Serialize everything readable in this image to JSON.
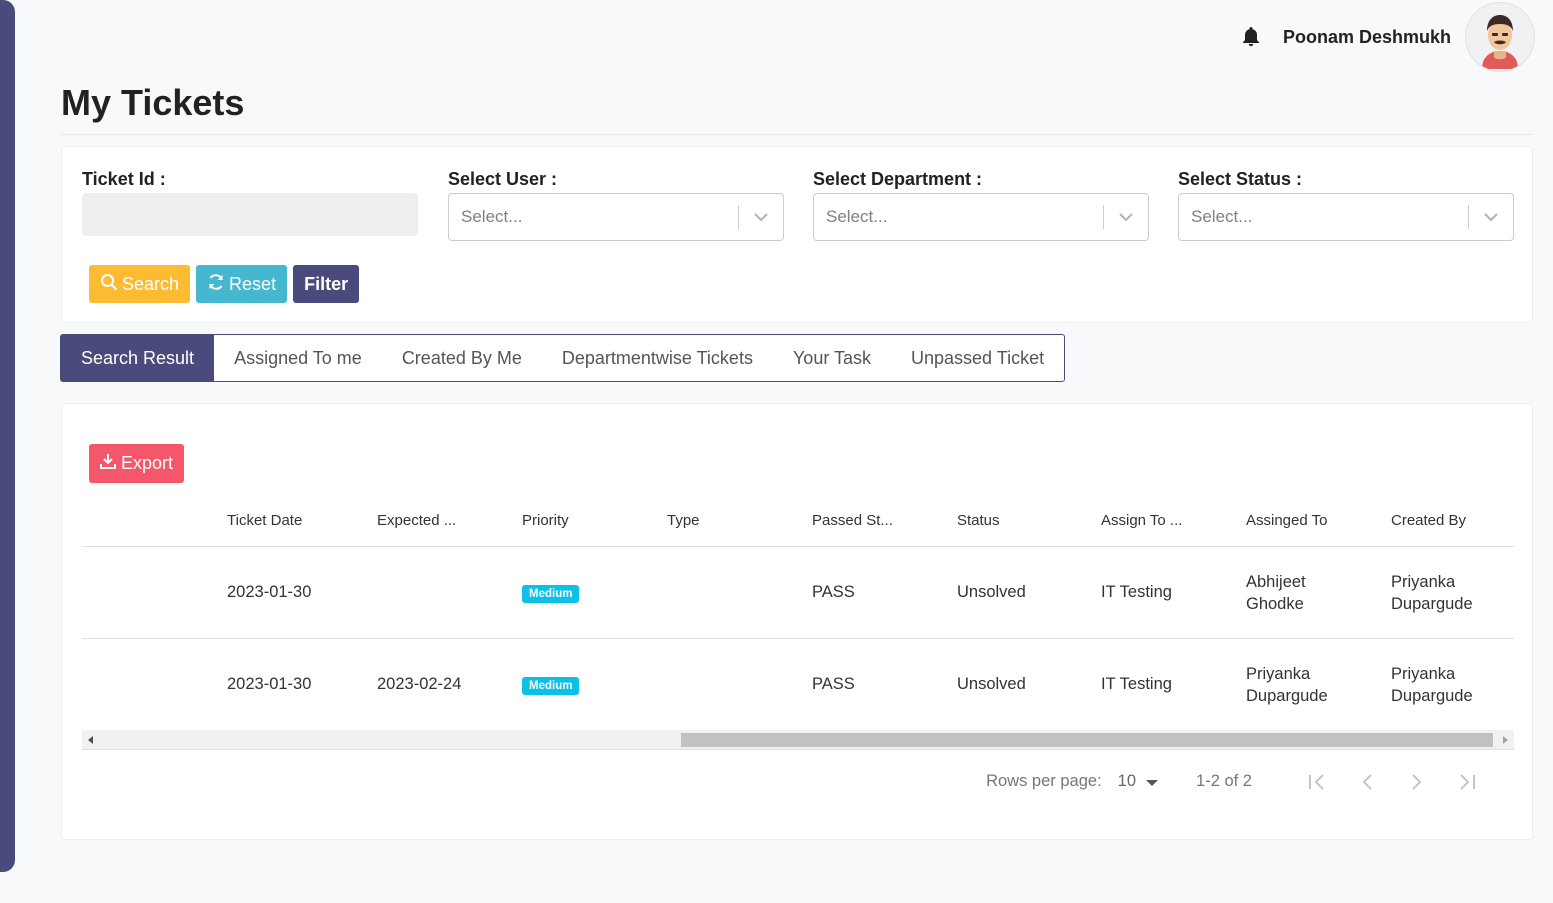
{
  "header": {
    "user_name": "Poonam Deshmukh"
  },
  "page": {
    "title": "My Tickets"
  },
  "filters": {
    "ticket_id_label": "Ticket Id :",
    "ticket_id_value": "",
    "user_label": "Select User :",
    "user_placeholder": "Select...",
    "department_label": "Select Department :",
    "department_placeholder": "Select...",
    "status_label": "Select Status :",
    "status_placeholder": "Select...",
    "search_label": "Search",
    "reset_label": "Reset",
    "filter_label": "Filter"
  },
  "tabs": [
    {
      "label": "Search Result",
      "active": true
    },
    {
      "label": "Assigned To me",
      "active": false
    },
    {
      "label": "Created By Me",
      "active": false
    },
    {
      "label": "Departmentwise Tickets",
      "active": false
    },
    {
      "label": "Your Task",
      "active": false
    },
    {
      "label": "Unpassed Ticket",
      "active": false
    }
  ],
  "table": {
    "export_label": "Export",
    "columns": [
      "",
      "Ticket Date",
      "Expected ...",
      "Priority",
      "Type",
      "Passed St...",
      "Status",
      "Assign To ...",
      "Assinged To",
      "Created By"
    ],
    "rows": [
      {
        "ticket_date": "2023-01-30",
        "expected": "",
        "priority": "Medium",
        "type": "",
        "passed_status": "PASS",
        "status": "Unsolved",
        "assign_to_dept": "IT Testing",
        "assigned_to": "Abhijeet Ghodke",
        "created_by": "Priyanka Dupargude"
      },
      {
        "ticket_date": "2023-01-30",
        "expected": "2023-02-24",
        "priority": "Medium",
        "type": "",
        "passed_status": "PASS",
        "status": "Unsolved",
        "assign_to_dept": "IT Testing",
        "assigned_to": "Priyanka Dupargude",
        "created_by": "Priyanka Dupargude"
      }
    ]
  },
  "pagination": {
    "rows_per_page_label": "Rows per page:",
    "rows_per_page_value": "10",
    "range": "1-2 of 2"
  },
  "colors": {
    "primary": "#4a4a7d",
    "search": "#fdbb31",
    "reset": "#45b8cf",
    "export": "#f4576a",
    "badge": "#0dc0e8"
  },
  "icons": {
    "bell": "bell-icon",
    "search": "search-icon",
    "reset": "refresh-icon",
    "export": "download-icon",
    "dropdown": "chevron-down-icon"
  }
}
